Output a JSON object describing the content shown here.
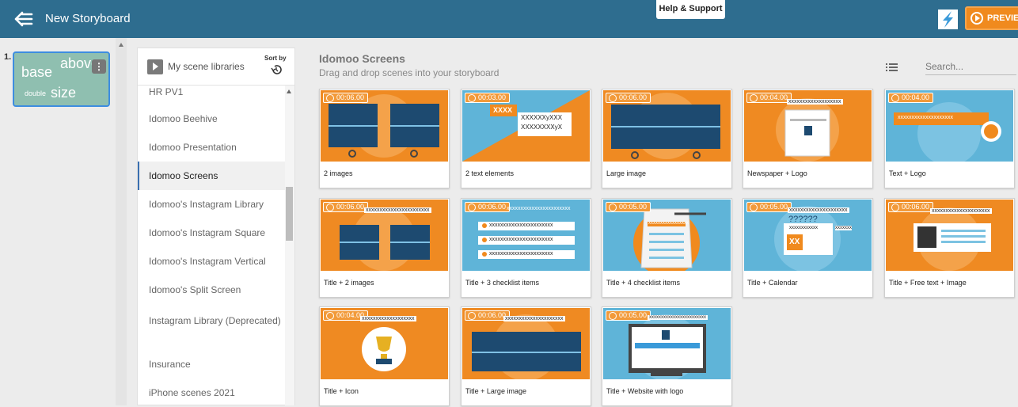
{
  "header": {
    "title": "New Storyboard",
    "help_label": "Help & Support",
    "preview_label": "PREVIEW",
    "colors": {
      "bar": "#2e6d8f",
      "accent": "#f08a1e"
    }
  },
  "storyboard": {
    "slide_number": "1.",
    "thumb_words": [
      "base",
      "above",
      "double",
      "size"
    ]
  },
  "libraries": {
    "title": "My scene libraries",
    "sort_label": "Sort by",
    "items": [
      "HR PV1",
      "Idomoo Beehive",
      "Idomoo Presentation",
      "Idomoo Screens",
      "Idomoo's Instagram Library",
      "Idomoo's Instagram Square",
      "Idomoo's Instagram Vertical",
      "Idomoo's Split Screen",
      "Instagram Library (Deprecated)",
      "Insurance",
      "iPhone scenes 2021"
    ],
    "active": "Idomoo Screens"
  },
  "main": {
    "title": "Idomoo Screens",
    "subtitle": "Drag and drop scenes into your storyboard",
    "search_placeholder": "Search...",
    "scenes": [
      {
        "label": "2 images",
        "duration": "00:06.00"
      },
      {
        "label": "2 text elements",
        "duration": "00:03.00",
        "texts": [
          "XXXX",
          "XXXXXXyXXX",
          "XXXXXXXXyX"
        ]
      },
      {
        "label": "Large image",
        "duration": "00:06.00"
      },
      {
        "label": "Newspaper + Logo",
        "duration": "00:04.00",
        "texts": [
          "xxxxxxxxxxxxxxxxxxx"
        ]
      },
      {
        "label": "Text + Logo",
        "duration": "00:04.00",
        "texts": [
          "xxxxxxxxxxxxxxxxxxxx"
        ]
      },
      {
        "label": "Title + 2 images",
        "duration": "00:06.00",
        "texts": [
          "xxxxxxxxxxxxxxxxxxxxxxx"
        ]
      },
      {
        "label": "Title + 3 checklist items",
        "duration": "00:06.00",
        "texts": [
          "xxxxxxxxxxxxxxxxxxxxxxx",
          "xxxxxxxxxxxxxxxxxxxxxxx",
          "xxxxxxxxxxxxxxxxxxxxxxx",
          "xxxxxxxxxxxxxxxxxxxxxxx"
        ]
      },
      {
        "label": "Title + 4 checklist items",
        "duration": "00:05.00",
        "texts": [
          "xxxxxxxxxxxxxxxxx"
        ]
      },
      {
        "label": "Title + Calendar",
        "duration": "00:05.00",
        "texts": [
          "xxxxxxxxxxxxxxxxxxxxx",
          "??????",
          "xxxxxxxxxxxx",
          "XX",
          "xxxxxxx"
        ]
      },
      {
        "label": "Title + Free text + Image",
        "duration": "00:06.00",
        "texts": [
          "xxxxxxxxxxxxxxxxxxxxx"
        ]
      },
      {
        "label": "Title + Icon",
        "duration": "00:04.00",
        "texts": [
          "xxxxxxxxxxxxxxxxxxx"
        ]
      },
      {
        "label": "Title + Large image",
        "duration": "00:06.00",
        "texts": [
          "xxxxxxxxxxxxxxxxxxxxx"
        ]
      },
      {
        "label": "Title + Website with logo",
        "duration": "00:05.00",
        "texts": [
          "xxxxxxxxxxxxxxxxxxxxxxxx"
        ]
      }
    ]
  }
}
